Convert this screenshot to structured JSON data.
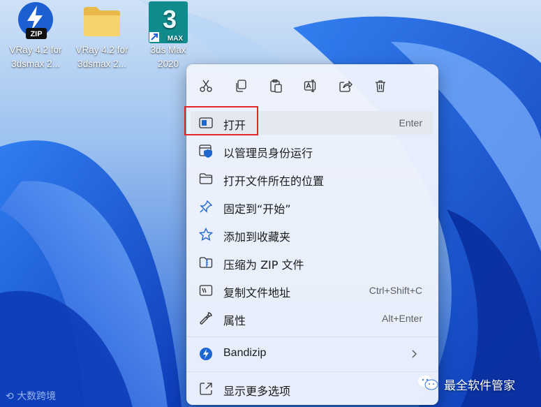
{
  "desktop": {
    "icons": [
      {
        "label": "VRay 4.2 for\n3dsmax 2...",
        "icon": "zip-icon"
      },
      {
        "label": "VRay 4.2 for\n3dsmax 2...",
        "icon": "folder-icon"
      },
      {
        "label": "3ds Max\n2020",
        "icon": "3dsmax-icon",
        "badge": "3",
        "badge_text": "MAX"
      }
    ]
  },
  "context_menu": {
    "toolbar": [
      "cut-icon",
      "copy-icon",
      "paste-icon",
      "rename-icon",
      "share-icon",
      "delete-icon"
    ],
    "items": [
      {
        "label": "打开",
        "shortcut": "Enter",
        "icon": "open-window-icon"
      },
      {
        "label": "以管理员身份运行",
        "shortcut": "",
        "icon": "admin-shield-icon"
      },
      {
        "label": "打开文件所在的位置",
        "shortcut": "",
        "icon": "folder-outline-icon"
      },
      {
        "label": "固定到“开始”",
        "shortcut": "",
        "icon": "pin-icon"
      },
      {
        "label": "添加到收藏夹",
        "shortcut": "",
        "icon": "star-icon"
      },
      {
        "label": "压缩为 ZIP 文件",
        "shortcut": "",
        "icon": "zip-folder-icon"
      },
      {
        "label": "复制文件地址",
        "shortcut": "Ctrl+Shift+C",
        "icon": "copy-path-icon"
      },
      {
        "label": "属性",
        "shortcut": "Alt+Enter",
        "icon": "wrench-icon"
      },
      {
        "label": "Bandizip",
        "shortcut": "",
        "icon": "bandizip-icon"
      },
      {
        "label": "显示更多选项",
        "shortcut": "",
        "icon": "more-options-icon"
      }
    ]
  },
  "watermarks": {
    "left": "大数跨境",
    "right": "最全软件管家"
  },
  "colors": {
    "highlight_border": "#e0262b",
    "accent": "#1e66d0"
  }
}
